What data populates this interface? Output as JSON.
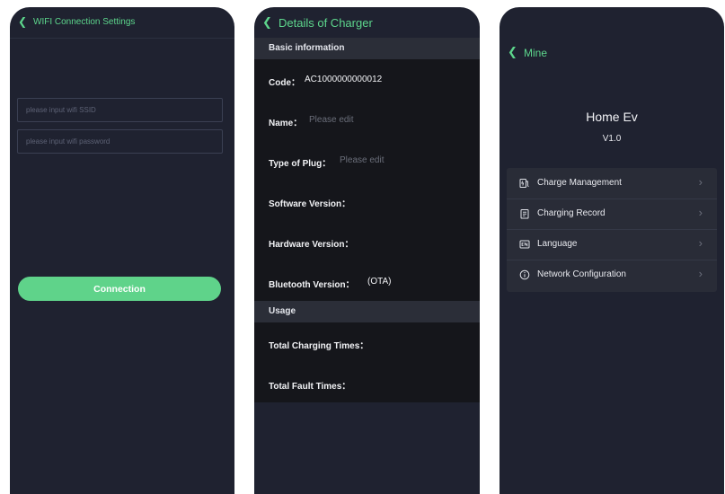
{
  "wifi_screen": {
    "title": "WIFI Connection Settings",
    "ssid_placeholder": "please input wifi SSID",
    "password_placeholder": "please input wifi password",
    "connect_label": "Connection",
    "accent_color": "#5fd38a",
    "back_icon": "chevron-left-icon"
  },
  "charger_screen": {
    "title": "Details of Charger",
    "basic_section": "Basic information",
    "code_label": "Code：",
    "code_value": "AC1000000000012",
    "name_label": "Name：",
    "name_placeholder": "Please edit",
    "plug_label": "Type of Plug：",
    "plug_placeholder": "Please edit",
    "software_label": "Software Version：",
    "hardware_label": "Hardware Version：",
    "bluetooth_label": "Bluetooth Version：",
    "bluetooth_value": "(OTA)",
    "usage_section": "Usage",
    "charging_times_label": "Total Charging Times：",
    "fault_times_label": "Total Fault Times："
  },
  "mine_screen": {
    "title": "Mine",
    "app_name": "Home Ev",
    "version": "V1.0",
    "menu": [
      {
        "label": "Charge Management",
        "icon": "charger-icon"
      },
      {
        "label": "Charging Record",
        "icon": "record-icon"
      },
      {
        "label": "Language",
        "icon": "language-icon"
      },
      {
        "label": "Network Configuration",
        "icon": "info-icon"
      }
    ]
  }
}
